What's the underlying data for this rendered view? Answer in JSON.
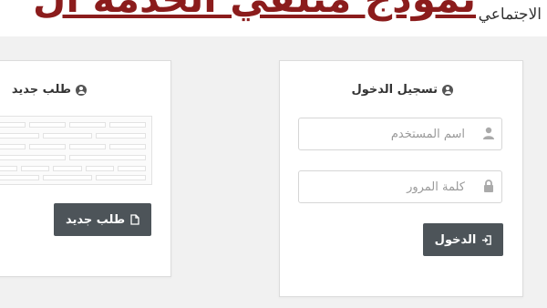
{
  "banner": {
    "title": "نموذج متلقي الخدمة ال",
    "logo_text": "الاجتماعي"
  },
  "login_panel": {
    "heading": "تسجيل الدخول",
    "username_placeholder": "اسم المستخدم",
    "password_placeholder": "كلمة المرور",
    "login_button_label": "الدخول"
  },
  "new_request_panel": {
    "heading": "طلب جديد",
    "button_label": "طلب جديد"
  },
  "colors": {
    "banner_red": "#8b1c1c",
    "button_bg": "#4d5459",
    "page_bg": "#f1f1f1"
  }
}
